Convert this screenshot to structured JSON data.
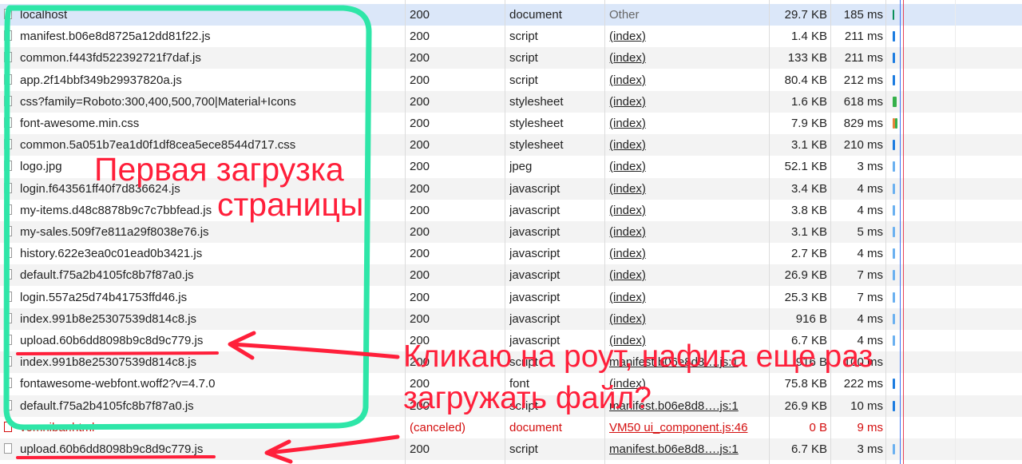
{
  "rows": [
    {
      "name": "localhost",
      "status": "200",
      "type": "document",
      "initiator": "Other",
      "initiator_link": false,
      "size": "29.7 KB",
      "time": "185 ms",
      "wf": [
        {
          "color": "#0b8f5a",
          "w": 2
        }
      ]
    },
    {
      "name": "manifest.b06e8d8725a12dd81f22.js",
      "status": "200",
      "type": "script",
      "initiator": "(index)",
      "initiator_link": true,
      "size": "1.4 KB",
      "time": "211 ms",
      "wf": [
        {
          "color": "#1b7be0",
          "w": 3
        }
      ]
    },
    {
      "name": "common.f443fd522392721f7daf.js",
      "status": "200",
      "type": "script",
      "initiator": "(index)",
      "initiator_link": true,
      "size": "133 KB",
      "time": "211 ms",
      "wf": [
        {
          "color": "#1b7be0",
          "w": 3
        }
      ]
    },
    {
      "name": "app.2f14bbf349b29937820a.js",
      "status": "200",
      "type": "script",
      "initiator": "(index)",
      "initiator_link": true,
      "size": "80.4 KB",
      "time": "212 ms",
      "wf": [
        {
          "color": "#1b7be0",
          "w": 3
        }
      ]
    },
    {
      "name": "css?family=Roboto:300,400,500,700|Material+Icons",
      "status": "200",
      "type": "stylesheet",
      "initiator": "(index)",
      "initiator_link": true,
      "size": "1.6 KB",
      "time": "618 ms",
      "wf": [
        {
          "color": "#35b04a",
          "w": 5
        }
      ]
    },
    {
      "name": "font-awesome.min.css",
      "status": "200",
      "type": "stylesheet",
      "initiator": "(index)",
      "initiator_link": true,
      "size": "7.9 KB",
      "time": "829 ms",
      "wf": [
        {
          "color": "#e6843c",
          "w": 3
        },
        {
          "color": "#35b04a",
          "w": 3
        }
      ]
    },
    {
      "name": "common.5a051b7ea1d0f1df8cea5ece8544d717.css",
      "status": "200",
      "type": "stylesheet",
      "initiator": "(index)",
      "initiator_link": true,
      "size": "3.1 KB",
      "time": "210 ms",
      "wf": [
        {
          "color": "#1b7be0",
          "w": 3
        }
      ]
    },
    {
      "name": "logo.jpg",
      "status": "200",
      "type": "jpeg",
      "initiator": "(index)",
      "initiator_link": true,
      "size": "52.1 KB",
      "time": "3 ms",
      "wf": [
        {
          "color": "#6ab0f0",
          "w": 3
        }
      ]
    },
    {
      "name": "login.f643561ff40f7d836624.js",
      "status": "200",
      "type": "javascript",
      "initiator": "(index)",
      "initiator_link": true,
      "size": "3.4 KB",
      "time": "4 ms",
      "wf": [
        {
          "color": "#6ab0f0",
          "w": 3
        }
      ]
    },
    {
      "name": "my-items.d48c8878b9c7c7bbfead.js",
      "status": "200",
      "type": "javascript",
      "initiator": "(index)",
      "initiator_link": true,
      "size": "3.8 KB",
      "time": "4 ms",
      "wf": [
        {
          "color": "#6ab0f0",
          "w": 3
        }
      ]
    },
    {
      "name": "my-sales.509f7e811a29f8038e76.js",
      "status": "200",
      "type": "javascript",
      "initiator": "(index)",
      "initiator_link": true,
      "size": "3.1 KB",
      "time": "5 ms",
      "wf": [
        {
          "color": "#6ab0f0",
          "w": 3
        }
      ]
    },
    {
      "name": "history.622e3ea0c01ead0b3421.js",
      "status": "200",
      "type": "javascript",
      "initiator": "(index)",
      "initiator_link": true,
      "size": "2.7 KB",
      "time": "4 ms",
      "wf": [
        {
          "color": "#6ab0f0",
          "w": 3
        }
      ]
    },
    {
      "name": "default.f75a2b4105fc8b7f87a0.js",
      "status": "200",
      "type": "javascript",
      "initiator": "(index)",
      "initiator_link": true,
      "size": "26.9 KB",
      "time": "7 ms",
      "wf": [
        {
          "color": "#6ab0f0",
          "w": 3
        }
      ]
    },
    {
      "name": "login.557a25d74b41753ffd46.js",
      "status": "200",
      "type": "javascript",
      "initiator": "(index)",
      "initiator_link": true,
      "size": "25.3 KB",
      "time": "7 ms",
      "wf": [
        {
          "color": "#6ab0f0",
          "w": 3
        }
      ]
    },
    {
      "name": "index.991b8e25307539d814c8.js",
      "status": "200",
      "type": "javascript",
      "initiator": "(index)",
      "initiator_link": true,
      "size": "916 B",
      "time": "4 ms",
      "wf": [
        {
          "color": "#6ab0f0",
          "w": 3
        }
      ]
    },
    {
      "name": "upload.60b6dd8098b9c8d9c779.js",
      "status": "200",
      "type": "javascript",
      "initiator": "(index)",
      "initiator_link": true,
      "size": "6.7 KB",
      "time": "4 ms",
      "wf": [
        {
          "color": "#6ab0f0",
          "w": 3
        }
      ]
    },
    {
      "name": "index.991b8e25307539d814c8.js",
      "status": "200",
      "type": "script",
      "initiator": "manifest.b06e8d8….js:1",
      "initiator_link": true,
      "size": "916 B",
      "time": "100 ms",
      "wf": []
    },
    {
      "name": "fontawesome-webfont.woff2?v=4.7.0",
      "status": "200",
      "type": "font",
      "initiator": "(index)",
      "initiator_link": true,
      "size": "75.8 KB",
      "time": "222 ms",
      "wf": [
        {
          "color": "#1b7be0",
          "w": 3
        }
      ]
    },
    {
      "name": "default.f75a2b4105fc8b7f87a0.js",
      "status": "200",
      "type": "script",
      "initiator": "manifest.b06e8d8….js:1",
      "initiator_link": true,
      "size": "26.9 KB",
      "time": "10 ms",
      "wf": [
        {
          "color": "#1b7be0",
          "w": 3
        }
      ]
    },
    {
      "name": "vomnibar.html",
      "status": "(canceled)",
      "type": "document",
      "initiator": "VM50 ui_component.js:46",
      "initiator_link": true,
      "size": "0 B",
      "time": "9 ms",
      "error": true,
      "wf": []
    },
    {
      "name": "upload.60b6dd8098b9c8d9c779.js",
      "status": "200",
      "type": "script",
      "initiator": "manifest.b06e8d8….js:1",
      "initiator_link": true,
      "size": "6.7 KB",
      "time": "3 ms",
      "wf": [
        {
          "color": "#6ab0f0",
          "w": 3
        }
      ]
    }
  ],
  "annotations": {
    "first_load_line1": "Первая загрузка",
    "first_load_line2": "страницы",
    "question_line1": "Кликаю на роут, нафига еще раз",
    "question_line2": "загружать файл?",
    "color": "#ff1f3a",
    "circle_color": "#2ee6a8"
  },
  "colors": {
    "selected_row": "#dbe7f9",
    "alt_row": "#f3f3f3",
    "error_text": "#d40f0f"
  }
}
